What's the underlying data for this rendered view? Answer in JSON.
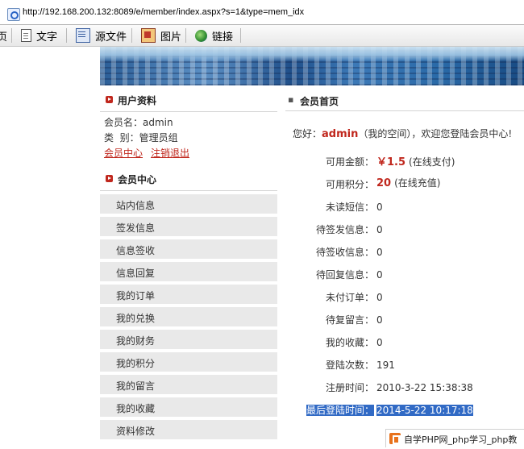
{
  "browser": {
    "address_url": "http://192.168.200.132:8089/e/member/index.aspx?s=1&type=mem_idx",
    "toolbar": [
      {
        "label": "文字",
        "icon": "page-icon"
      },
      {
        "label": "源文件",
        "icon": "source-icon"
      },
      {
        "label": "图片",
        "icon": "image-icon"
      },
      {
        "label": "链接",
        "icon": "link-globe-icon"
      }
    ],
    "toolbar_left_fragment": "页"
  },
  "profile": {
    "title": "用户资料",
    "username_label": "会员名：",
    "username": "admin",
    "group_label": "类  别：",
    "group": "管理员组",
    "links": [
      "会员中心",
      "注销退出"
    ]
  },
  "member_center": {
    "title": "会员中心",
    "menu": [
      "站内信息",
      "签发信息",
      "信息签收",
      "信息回复",
      "我的订单",
      "我的兑换",
      "我的财务",
      "我的积分",
      "我的留言",
      "我的收藏",
      "资料修改"
    ]
  },
  "main": {
    "title": "会员首页",
    "welcome_prefix": "您好：",
    "welcome_name": "admin",
    "welcome_suffix": "（我的空间），欢迎您登陆会员中心!",
    "stats": [
      {
        "label": "可用金额：",
        "value": "￥1.5",
        "extra": "(在线支付)",
        "highlight": true
      },
      {
        "label": "可用积分：",
        "value": "20",
        "extra": "(在线充值)",
        "highlight": true
      },
      {
        "label": "未读短信：",
        "value": "0"
      },
      {
        "label": "待签发信息：",
        "value": "0"
      },
      {
        "label": "待签收信息：",
        "value": "0"
      },
      {
        "label": "待回复信息：",
        "value": "0"
      },
      {
        "label": "未付订单：",
        "value": "0"
      },
      {
        "label": "待复留言：",
        "value": "0"
      },
      {
        "label": "我的收藏：",
        "value": "0"
      },
      {
        "label": "登陆次数：",
        "value": "191"
      },
      {
        "label": "注册时间：",
        "value": "2010-3-22 15:38:38"
      },
      {
        "label": "最后登陆时间：",
        "value": "2014-5-22 10:17:18",
        "selected": true
      }
    ]
  },
  "watermark": "自学PHP网_php学习_php教"
}
